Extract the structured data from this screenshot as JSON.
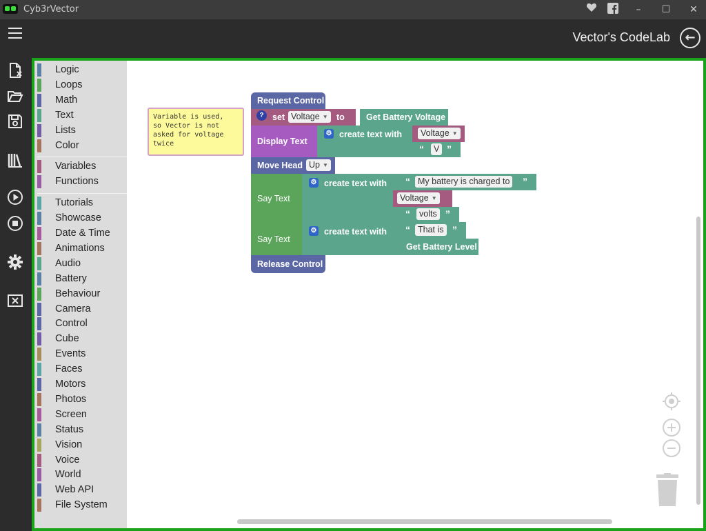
{
  "window": {
    "title": "Cyb3rVector",
    "minimize": "–",
    "maximize": "☐",
    "close": "✕"
  },
  "header": {
    "title": "Vector's CodeLab"
  },
  "toolbox": {
    "groups": [
      [
        {
          "label": "Logic",
          "color": "#5b80a5"
        },
        {
          "label": "Loops",
          "color": "#5ba55b"
        },
        {
          "label": "Math",
          "color": "#5b67a5"
        },
        {
          "label": "Text",
          "color": "#5ba58c"
        },
        {
          "label": "Lists",
          "color": "#745ba5"
        },
        {
          "label": "Color",
          "color": "#a5745b"
        }
      ],
      [
        {
          "label": "Variables",
          "color": "#a55b80"
        },
        {
          "label": "Functions",
          "color": "#995ba5"
        }
      ],
      [
        {
          "label": "Tutorials",
          "color": "#5ba5a5"
        },
        {
          "label": "Showcase",
          "color": "#5b80a5"
        },
        {
          "label": "Date & Time",
          "color": "#a55b99"
        },
        {
          "label": "Animations",
          "color": "#a5745b"
        },
        {
          "label": "Audio",
          "color": "#5ba58c"
        },
        {
          "label": "Battery",
          "color": "#5b80a5"
        },
        {
          "label": "Behaviour",
          "color": "#5ba55b"
        },
        {
          "label": "Camera",
          "color": "#5b67a5"
        },
        {
          "label": "Control",
          "color": "#5b67a5"
        },
        {
          "label": "Cube",
          "color": "#745ba5"
        },
        {
          "label": "Events",
          "color": "#a58c5b"
        },
        {
          "label": "Faces",
          "color": "#5ba5a5"
        },
        {
          "label": "Motors",
          "color": "#5b67a5"
        },
        {
          "label": "Photos",
          "color": "#a5745b"
        },
        {
          "label": "Screen",
          "color": "#a55b99"
        },
        {
          "label": "Status",
          "color": "#5b80a5"
        },
        {
          "label": "Vision",
          "color": "#a5a55b"
        },
        {
          "label": "Voice",
          "color": "#a55b80"
        },
        {
          "label": "World",
          "color": "#995ba5"
        },
        {
          "label": "Web API",
          "color": "#5b67a5"
        },
        {
          "label": "File System",
          "color": "#a5745b"
        }
      ]
    ]
  },
  "comment": {
    "text": "Variable is used,\nso Vector is not\nasked for voltage\ntwice"
  },
  "blocks": {
    "request_control": "Request Control",
    "set": "set",
    "voltage_var": "Voltage",
    "to": "to",
    "get_battery_voltage": "Get Battery Voltage",
    "display_text": "Display Text",
    "create_text_with": "create text with",
    "voltage_var2": "Voltage",
    "v_text": "V",
    "move_head": "Move Head",
    "up": "Up",
    "say_text_1": "Say Text",
    "create_text_with_2": "create text with",
    "my_battery": "My battery is charged to",
    "voltage_var3": "Voltage",
    "volts": "volts",
    "say_text_2": "Say Text",
    "create_text_with_3": "create text with",
    "that_is": "That is",
    "get_battery_level": "Get Battery Level",
    "release_control": "Release Control"
  },
  "colors": {
    "accent_frame": "#1aa31a",
    "control": "#5b67a5",
    "variable": "#a55b80",
    "text": "#5ba58c",
    "say": "#5ba55b",
    "battery": "#5ba58c"
  },
  "icons": {
    "title_logo": "vector-logo-icon",
    "favorite": "heart-icon",
    "facebook": "facebook-icon"
  }
}
